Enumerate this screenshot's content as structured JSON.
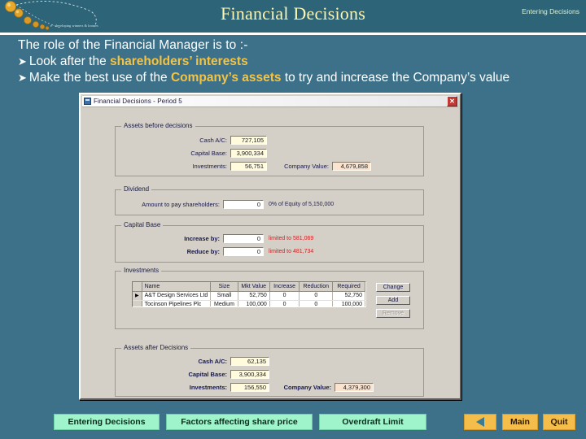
{
  "header": {
    "title": "Financial Decisions",
    "right_label": "Entering Decisions",
    "logo_tagline": "e - developing winners & loosers"
  },
  "bullets": {
    "intro": "The role of the Financial Manager is to :-",
    "b1_pre": "Look after the ",
    "b1_hl": "shareholders’ interests",
    "b2_pre": "Make the best use of the ",
    "b2_hl": "Company’s assets",
    "b2_post": " to try and increase the Company’s value",
    "marker": "➤",
    "highlight_color": "#f5c342"
  },
  "dialog": {
    "title": "Financial Decisions - Period 5",
    "close_label": "✕",
    "assets_before": {
      "legend": "Assets before decisions",
      "cash_label": "Cash A/C:",
      "cash_value": "727,105",
      "capital_label": "Capital Base:",
      "capital_value": "3,900,334",
      "investments_label": "Investments:",
      "investments_value": "56,751",
      "company_value_label": "Company Value:",
      "company_value": "4,679,858"
    },
    "dividend": {
      "legend": "Dividend",
      "amount_label": "Amount to pay shareholders:",
      "amount_value": "0",
      "note": "0% of Equity of 5,150,000"
    },
    "capital_base": {
      "legend": "Capital Base",
      "increase_label": "Increase by:",
      "increase_value": "0",
      "increase_note": "limited to 581,069",
      "reduce_label": "Reduce by:",
      "reduce_value": "0",
      "reduce_note": "limited to 481,734"
    },
    "investments": {
      "legend": "Investments",
      "columns": [
        "Name",
        "Size",
        "Mkt Value",
        "Increase",
        "Reduction",
        "Required"
      ],
      "rows": [
        {
          "marker": "▶",
          "name": "A&T Design Services Ltd",
          "size": "Small",
          "mkt_value": "52,750",
          "increase": "0",
          "reduction": "0",
          "required": "52,750"
        },
        {
          "marker": "",
          "name": "Tocinson Pipelines Plc",
          "size": "Medium",
          "mkt_value": "100,000",
          "increase": "0",
          "reduction": "0",
          "required": "100,000"
        }
      ],
      "btn_change": "Change",
      "btn_add": "Add",
      "btn_remove": "Remove"
    },
    "assets_after": {
      "legend": "Assets after Decisions",
      "cash_label": "Cash A/C:",
      "cash_value": "62,135",
      "capital_label": "Capital Base:",
      "capital_value": "3,900,334",
      "investments_label": "Investments:",
      "investments_value": "156,550",
      "company_value_label": "Company Value:",
      "company_value": "4,379,300"
    }
  },
  "footer": {
    "btn_entering": "Entering Decisions",
    "btn_factors": "Factors affecting share price",
    "btn_overdraft": "Overdraft Limit",
    "btn_back_icon": "back-triangle",
    "btn_main": "Main",
    "btn_quit": "Quit"
  }
}
